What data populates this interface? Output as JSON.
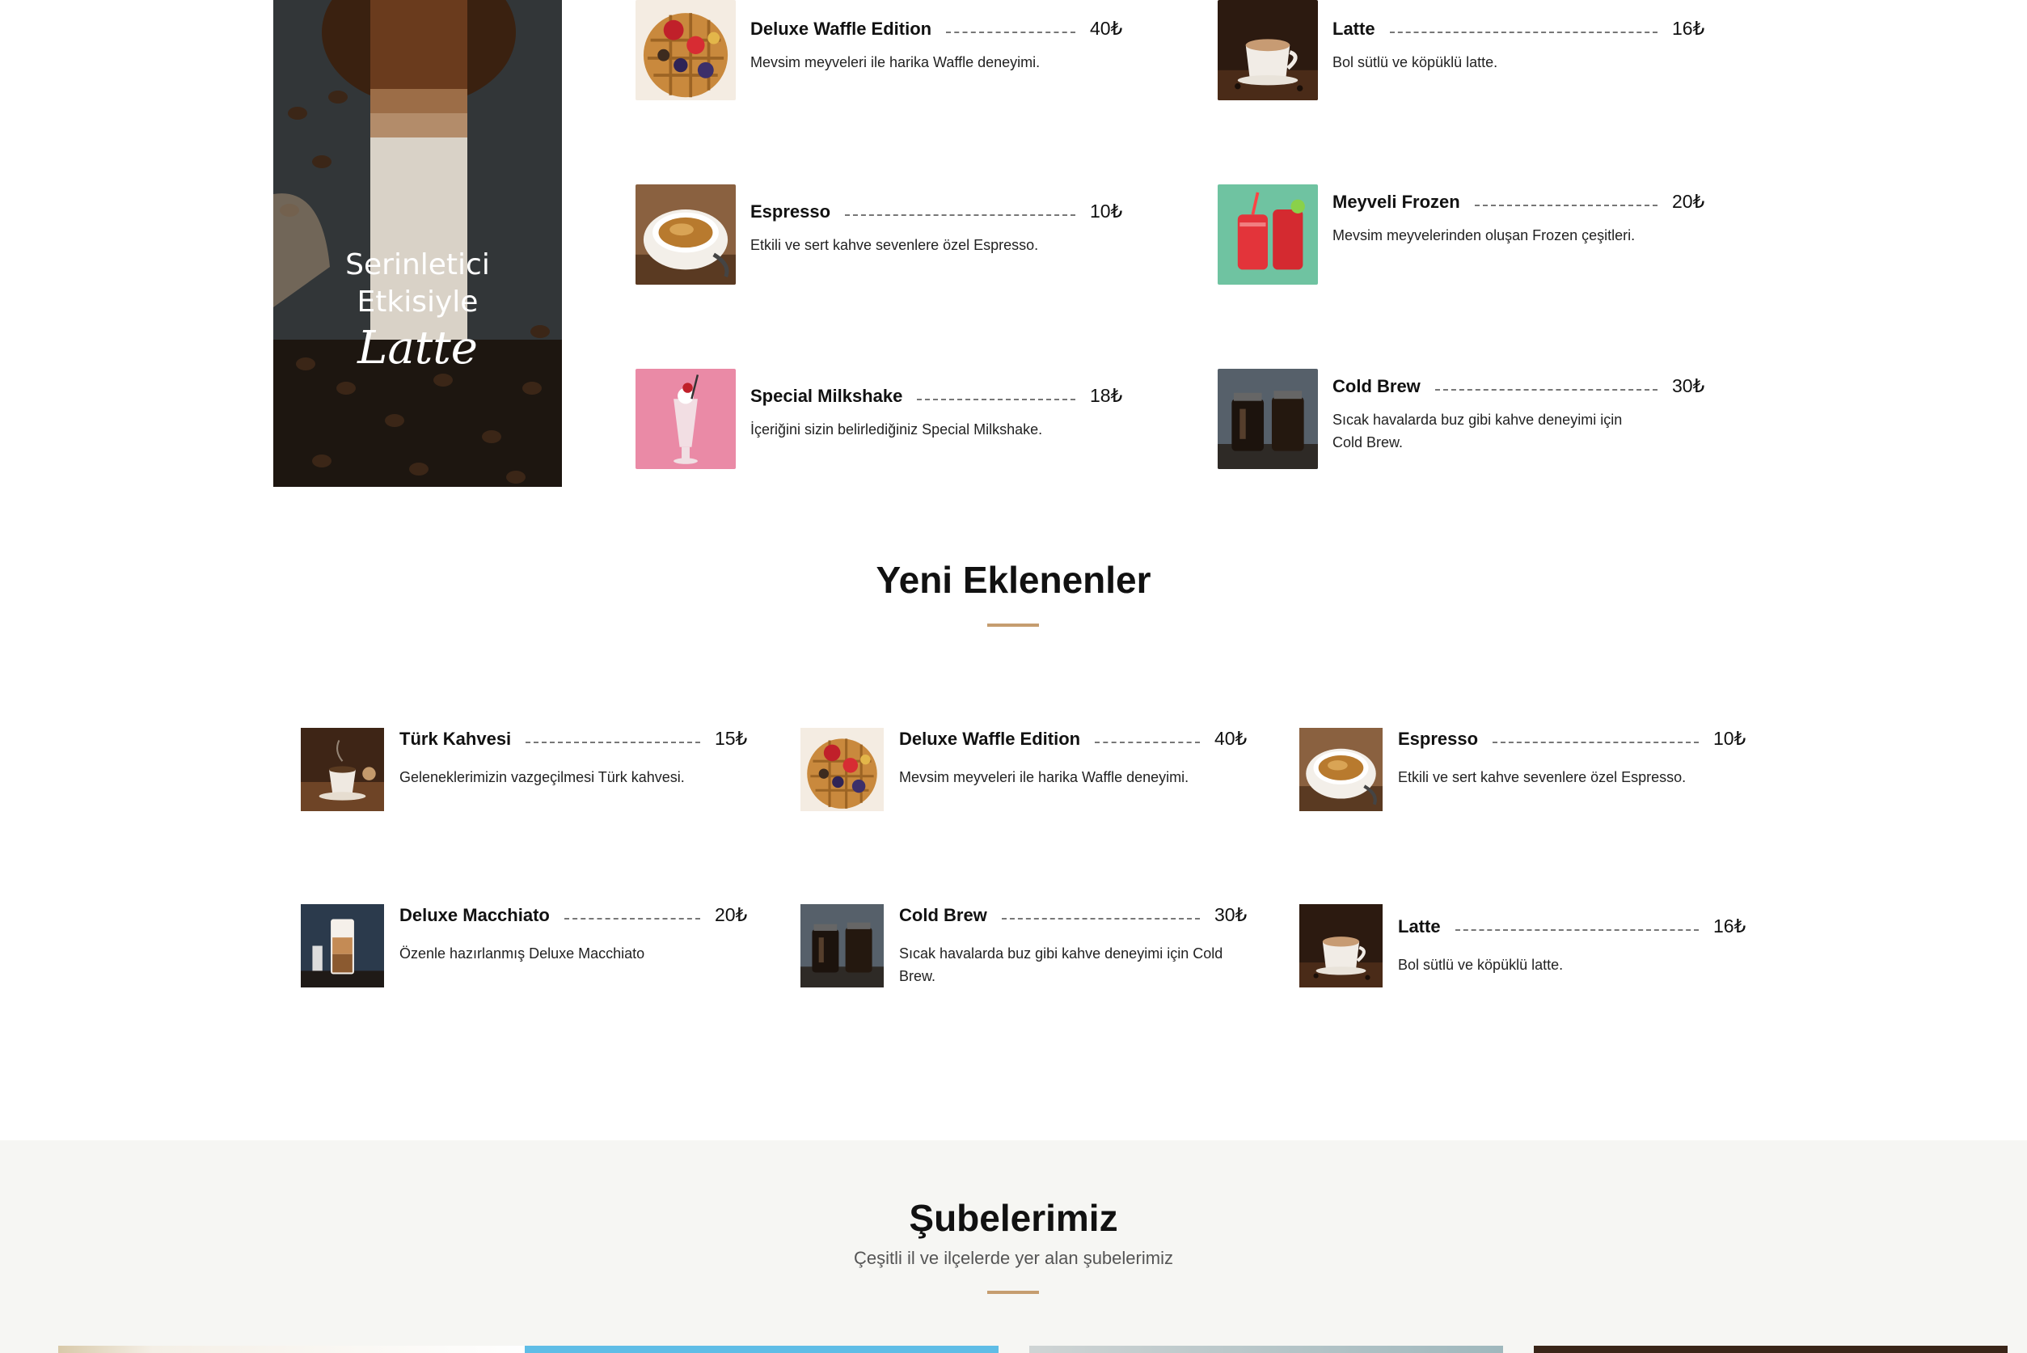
{
  "promo": {
    "line1": "Serinletici",
    "line2": "Etkisiyle",
    "line3": "Latte"
  },
  "menu_left": [
    {
      "name": "Deluxe Waffle Edition",
      "price": "40₺",
      "desc": "Mevsim meyveleri ile harika Waffle deneyimi.",
      "icon": "waffle-image"
    },
    {
      "name": "Espresso",
      "price": "10₺",
      "desc": "Etkili ve sert kahve sevenlere özel Espresso.",
      "icon": "espresso-image"
    },
    {
      "name": "Special Milkshake",
      "price": "18₺",
      "desc": "İçeriğini sizin belirlediğiniz Special Milkshake.",
      "icon": "milkshake-image"
    }
  ],
  "menu_right": [
    {
      "name": "Latte",
      "price": "16₺",
      "desc": "Bol sütlü ve köpüklü latte.",
      "icon": "latte-image"
    },
    {
      "name": "Meyveli Frozen",
      "price": "20₺",
      "desc": "Mevsim meyvelerinden oluşan Frozen çeşitleri.",
      "icon": "frozen-image"
    },
    {
      "name": "Cold Brew",
      "price": "30₺",
      "desc": "Sıcak havalarda buz gibi kahve deneyimi için Cold Brew.",
      "icon": "cold-brew-image"
    }
  ],
  "new_section": {
    "title": "Yeni Eklenenler",
    "items": [
      {
        "name": "Türk Kahvesi",
        "price": "15₺",
        "desc": "Geleneklerimizin vazgeçilmesi Türk kahvesi.",
        "icon": "turkish-coffee-image"
      },
      {
        "name": "Deluxe Waffle Edition",
        "price": "40₺",
        "desc": "Mevsim meyveleri ile harika Waffle deneyimi.",
        "icon": "waffle-image"
      },
      {
        "name": "Espresso",
        "price": "10₺",
        "desc": "Etkili ve sert kahve sevenlere özel Espresso.",
        "icon": "espresso-image"
      },
      {
        "name": "Deluxe Macchiato",
        "price": "20₺",
        "desc": "Özenle hazırlanmış Deluxe Macchiato",
        "icon": "macchiato-image"
      },
      {
        "name": "Cold Brew",
        "price": "30₺",
        "desc": "Sıcak havalarda buz gibi kahve deneyimi için Cold Brew.",
        "icon": "cold-brew-image"
      },
      {
        "name": "Latte",
        "price": "16₺",
        "desc": "Bol sütlü ve köpüklü latte.",
        "icon": "latte-image"
      }
    ]
  },
  "branches": {
    "title": "Şubelerimiz",
    "subtitle": "Çeşitli il ve ilçelerde yer alan şubelerimiz"
  },
  "colors": {
    "accent": "#c59d6f",
    "branches_bg": "#f6f6f3"
  }
}
